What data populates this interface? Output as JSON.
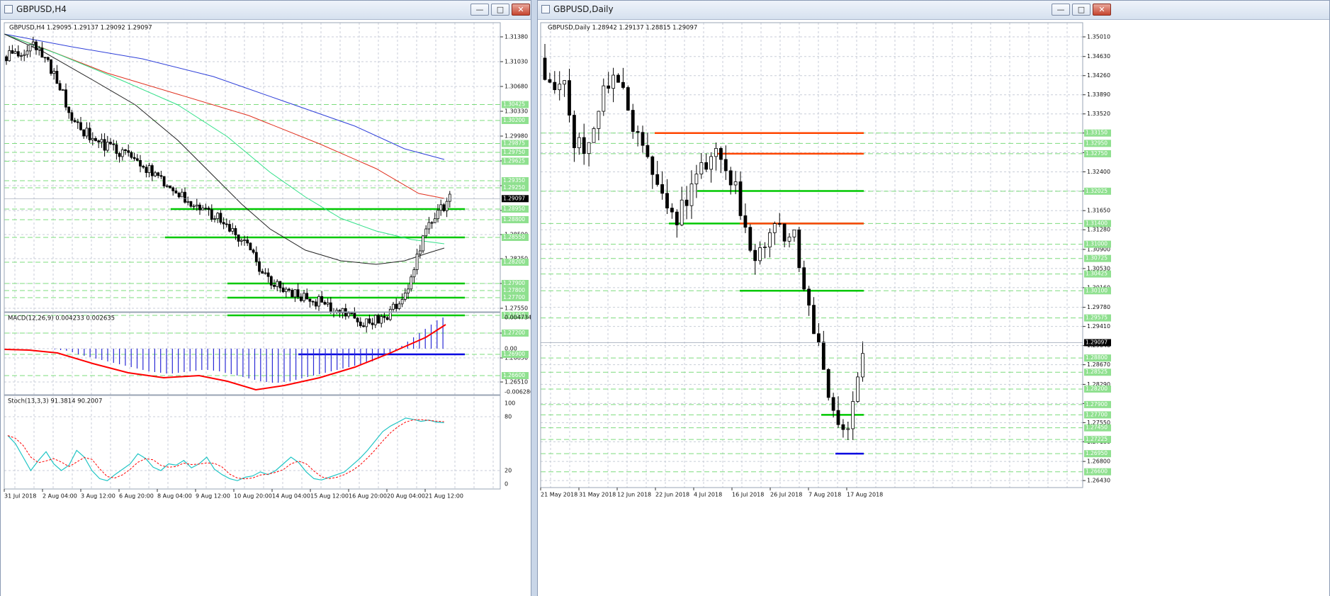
{
  "colors": {
    "support": "#00c800",
    "resistance": "#ff4500",
    "low_line": "#0000e0",
    "ma_blue": "#2e3fd9",
    "ma_red": "#e0301e",
    "ma_green": "#33e089",
    "ma_black": "#222222",
    "macd_hist": "#2b2bd6",
    "macd_signal": "#ff0000",
    "stoch_main": "#20c5c5",
    "stoch_signal": "#ff0000"
  },
  "left_window": {
    "title": "GBPUSD,H4",
    "buttons": {
      "minimize": "minimize-icon",
      "maximize": "maximize-icon",
      "close": "close-icon"
    },
    "main": {
      "info": "GBPUSD,H4  1.29095 1.29137 1.29092 1.29097",
      "price_ticks": [
        "1.31380",
        "1.31030",
        "1.30680",
        "1.30330",
        "1.29980",
        "1.29630",
        "1.29280",
        "1.28930",
        "1.28590",
        "1.28250",
        "1.27900",
        "1.27550",
        "1.27200",
        "1.26850",
        "1.26510"
      ],
      "level_labels": [
        "1.30425",
        "1.30200",
        "1.29875",
        "1.29750",
        "1.29625",
        "1.29350",
        "1.29250",
        "1.28950",
        "1.28800",
        "1.28550",
        "1.28200",
        "1.27900",
        "1.27800",
        "1.27700",
        "1.27450",
        "1.27200",
        "1.26900",
        "1.26600"
      ],
      "current_price": "1.29097"
    },
    "macd": {
      "label": "MACD(12,26,9) 0.004233 0.002635",
      "ticks": [
        "0.004734",
        "0.00",
        "-0.006286"
      ]
    },
    "stoch": {
      "label": "Stoch(13,3,3) 91.3814 90.2007",
      "ticks": [
        "100",
        "80",
        "20",
        "0"
      ]
    },
    "time_labels": [
      "31 Jul 2018",
      "2 Aug 04:00",
      "3 Aug 12:00",
      "6 Aug 20:00",
      "8 Aug 04:00",
      "9 Aug 12:00",
      "10 Aug 20:00",
      "14 Aug 04:00",
      "15 Aug 12:00",
      "16 Aug 20:00",
      "20 Aug 04:00",
      "21 Aug 12:00"
    ]
  },
  "right_window": {
    "title": "GBPUSD,Daily",
    "buttons": {
      "minimize": "minimize-icon",
      "maximize": "maximize-icon",
      "close": "close-icon"
    },
    "main": {
      "info": "GBPUSD,Daily  1.28942 1.29137 1.28815 1.29097",
      "price_ticks": [
        "1.35010",
        "1.34630",
        "1.34260",
        "1.33890",
        "1.33520",
        "1.33150",
        "1.32770",
        "1.32400",
        "1.32030",
        "1.31650",
        "1.31280",
        "1.30900",
        "1.30530",
        "1.30160",
        "1.29780",
        "1.29410",
        "1.29040",
        "1.28670",
        "1.28290",
        "1.27920",
        "1.27550",
        "1.27180",
        "1.26800",
        "1.26430"
      ],
      "level_labels": [
        "1.33150",
        "1.32950",
        "1.32750",
        "1.32025",
        "1.31400",
        "1.31000",
        "1.30725",
        "1.30425",
        "1.30100",
        "1.29575",
        "1.28800",
        "1.28525",
        "1.28200",
        "1.27900",
        "1.27700",
        "1.27450",
        "1.27225",
        "1.26950",
        "1.26600"
      ],
      "current_price": "1.29097"
    },
    "time_labels": [
      "21 May 2018",
      "31 May 2018",
      "12 Jun 2018",
      "22 Jun 2018",
      "4 Jul 2018",
      "16 Jul 2018",
      "26 Jul 2018",
      "7 Aug 2018",
      "17 Aug 2018"
    ]
  }
}
